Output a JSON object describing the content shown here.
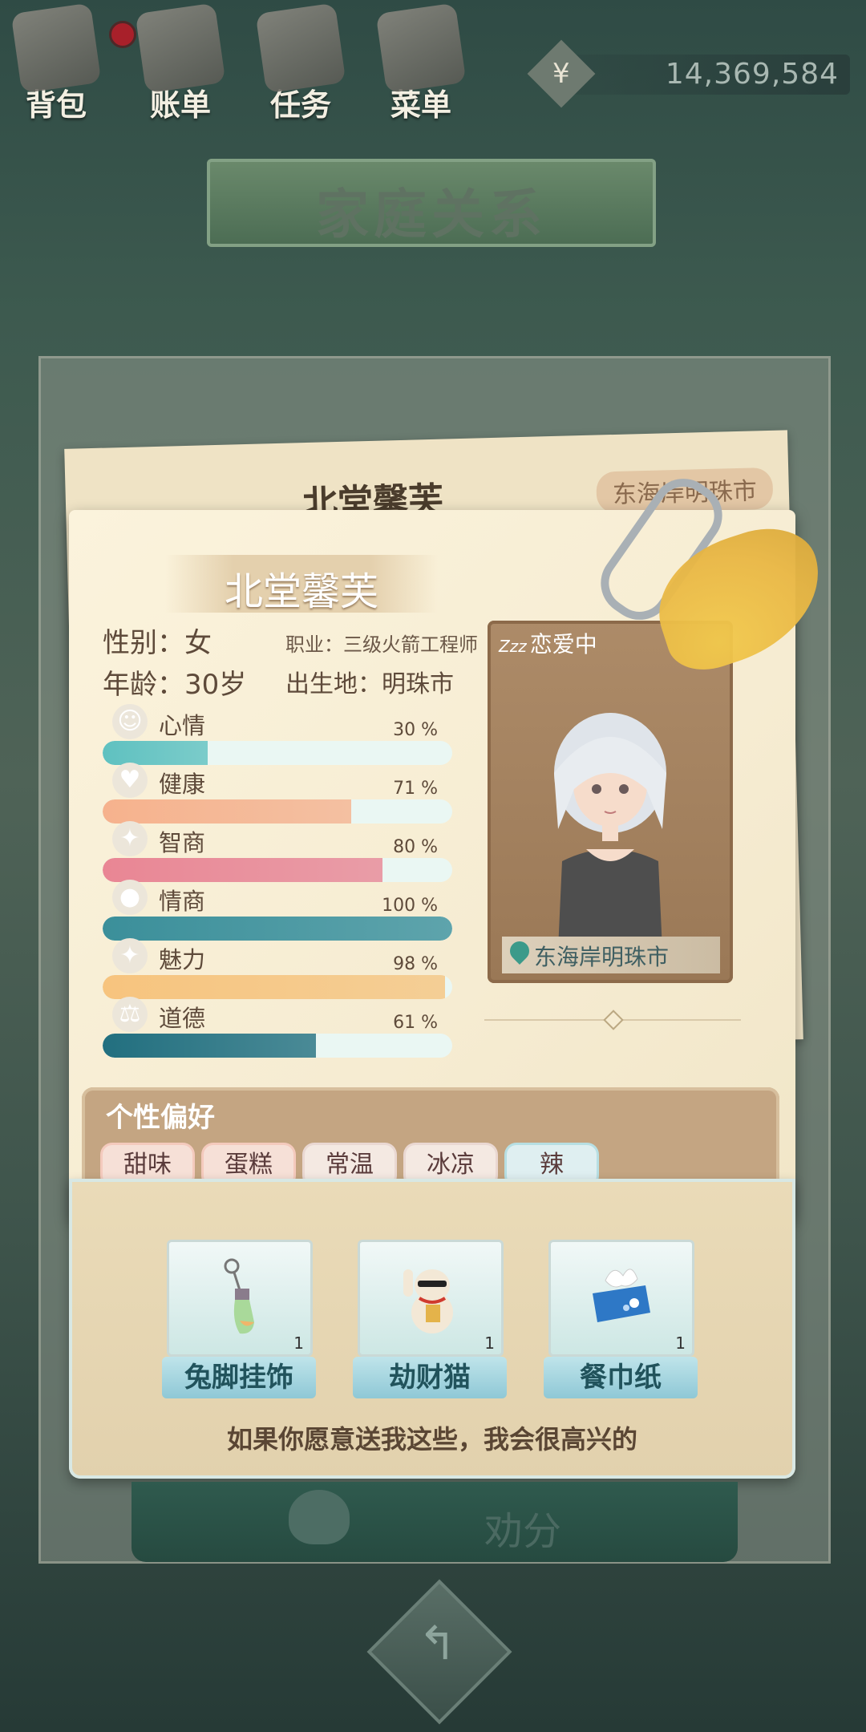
{
  "top_bar": {
    "buttons": [
      {
        "label": "背包",
        "icon": "backpack-icon",
        "has_alert": true
      },
      {
        "label": "账单",
        "icon": "bill-icon"
      },
      {
        "label": "任务",
        "icon": "task-icon"
      },
      {
        "label": "菜单",
        "icon": "menu-icon"
      }
    ],
    "money": {
      "currency": "¥",
      "amount": "14,369,584"
    }
  },
  "page_title": "家庭关系",
  "back_card": {
    "name": "北堂馨芙",
    "location": "东海岸明珠市"
  },
  "profile": {
    "name": "北堂馨芙",
    "gender": "性别：女",
    "occupation": "职业：三级火箭工程师",
    "age": "年龄：30岁",
    "birthplace": "出生地：明珠市",
    "status": "恋爱中",
    "status_icon": "Zzz",
    "location": "东海岸明珠市"
  },
  "stats": [
    {
      "name": "心情",
      "pct_label": "30 %",
      "value": 30,
      "icon": "smile-icon",
      "glyph": "☺",
      "color": "#5fc1c0"
    },
    {
      "name": "健康",
      "pct_label": "71 %",
      "value": 71,
      "icon": "heart-icon",
      "glyph": "♥",
      "color": "#f6b28d"
    },
    {
      "name": "智商",
      "pct_label": "80 %",
      "value": 80,
      "icon": "bulb-icon",
      "glyph": "✦",
      "color": "#e98694"
    },
    {
      "name": "情商",
      "pct_label": "100 %",
      "value": 100,
      "icon": "apple-icon",
      "glyph": "●",
      "color": "#3b8f9a"
    },
    {
      "name": "魅力",
      "pct_label": "98 %",
      "value": 98,
      "icon": "sparkle-icon",
      "glyph": "✦",
      "color": "#f7c47e"
    },
    {
      "name": "道德",
      "pct_label": "61 %",
      "value": 61,
      "icon": "scale-icon",
      "glyph": "⚖",
      "color": "#226f7f"
    }
  ],
  "preferences": {
    "title": "个性偏好",
    "tags": [
      "甜味",
      "蛋糕",
      "常温",
      "冰凉",
      "辣"
    ]
  },
  "gifts": [
    {
      "name": "兔脚挂饰",
      "count": "1"
    },
    {
      "name": "劫财猫",
      "count": "1"
    },
    {
      "name": "餐巾纸",
      "count": "1"
    }
  ],
  "wish_text": "如果你愿意送我这些，我会很高兴的",
  "persuade_label": "劝分",
  "back_icon": "↰"
}
